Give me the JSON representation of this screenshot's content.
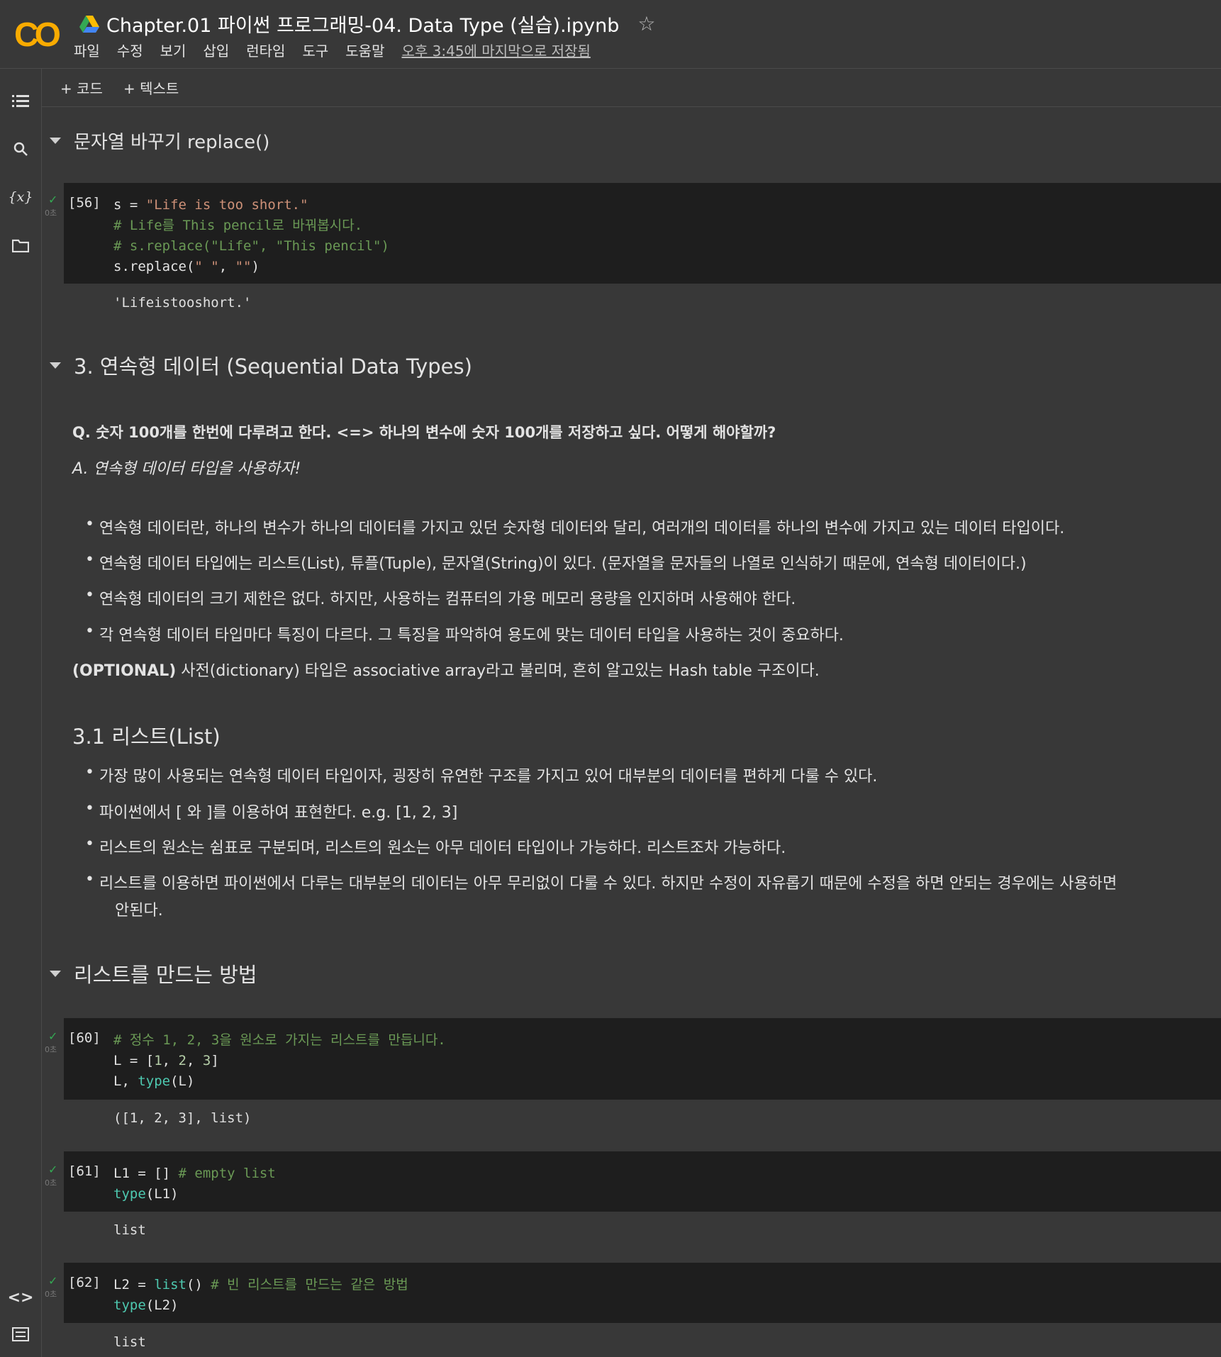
{
  "header": {
    "logo": "CO",
    "title": "Chapter.01 파이썬 프로그래밍-04. Data Type (실습).ipynb",
    "menu": [
      "파일",
      "수정",
      "보기",
      "삽입",
      "런타임",
      "도구",
      "도움말"
    ],
    "saved_status": "오후 3:45에 마지막으로 저장됨"
  },
  "toolbar": {
    "add_code": "+ 코드",
    "add_text": "+ 텍스트"
  },
  "icons": {
    "toc": "toc-icon",
    "search": "search-icon",
    "variables": "variables-icon",
    "files": "folder-icon",
    "code_snippets": "code-icon",
    "terminal": "terminal-icon"
  },
  "variables_label": "{x}",
  "sections": {
    "replace": "문자열 바꾸기 replace()",
    "sequential": "3. 연속형 데이터 (Sequential Data Types)",
    "list_sub": "3.1 리스트(List)",
    "make_list": "리스트를 만드는 방법"
  },
  "cells": {
    "c56": {
      "prompt": "[56]",
      "time": "0초",
      "lines": [
        "s = \"Life is too short.\"",
        "# Life를 This pencil로 바꿔봅시다.",
        "# s.replace(\"Life\", \"This pencil\")",
        "s.replace(\" \", \"\")"
      ],
      "output": "'Lifeistooshort.'"
    },
    "c60": {
      "prompt": "[60]",
      "time": "0초",
      "lines": [
        "# 정수 1, 2, 3을 원소로 가지는 리스트를 만듭니다.",
        "L = [1, 2, 3]",
        "L, type(L)"
      ],
      "output": "([1, 2, 3], list)"
    },
    "c61": {
      "prompt": "[61]",
      "time": "0초",
      "lines": [
        "L1 = [] # empty list",
        "type(L1)"
      ],
      "output": "list"
    },
    "c62": {
      "prompt": "[62]",
      "time": "0초",
      "lines": [
        "L2 = list() # 빈 리스트를 만드는 같은 방법",
        "type(L2)"
      ],
      "output": "list"
    }
  },
  "text": {
    "question": "Q. 숫자 100개를 한번에 다루려고 한다. <=> 하나의 변수에 숫자 100개를 저장하고 싶다. 어떻게 해야할까?",
    "answer": "A. 연속형 데이터 타입을 사용하자!",
    "bullets_seq": [
      "연속형 데이터란, 하나의 변수가 하나의 데이터를 가지고 있던 숫자형 데이터와 달리, 여러개의 데이터를 하나의 변수에 가지고 있는 데이터 타입이다.",
      "연속형 데이터 타입에는 리스트(List), 튜플(Tuple), 문자열(String)이 있다. (문자열을 문자들의 나열로 인식하기 때문에, 연속형 데이터이다.)",
      "연속형 데이터의 크기 제한은 없다. 하지만, 사용하는 컴퓨터의 가용 메모리 용량을 인지하며 사용해야 한다.",
      "각 연속형 데이터 타입마다 특징이 다르다. 그 특징을 파악하여 용도에 맞는 데이터 타입을 사용하는 것이 중요하다."
    ],
    "optional_bold": "(OPTIONAL)",
    "optional_rest": " 사전(dictionary) 타입은 associative array라고 불리며, 흔히 알고있는 Hash table 구조이다.",
    "bullets_list": [
      "가장 많이 사용되는 연속형 데이터 타입이자, 굉장히 유연한 구조를 가지고 있어 대부분의 데이터를 편하게 다룰 수 있다.",
      "파이썬에서 [ 와 ]를 이용하여 표현한다. e.g. [1, 2, 3]",
      "리스트의 원소는 쉼표로 구분되며, 리스트의 원소는 아무 데이터 타입이나 가능하다. 리스트조차 가능하다.",
      "리스트를 이용하면 파이썬에서 다루는 대부분의 데이터는 아무 무리없이 다룰 수 있다. 하지만 수정이 자유롭기 때문에 수정을 하면 안되는 경우에는 사용하면",
      "안된다."
    ]
  }
}
